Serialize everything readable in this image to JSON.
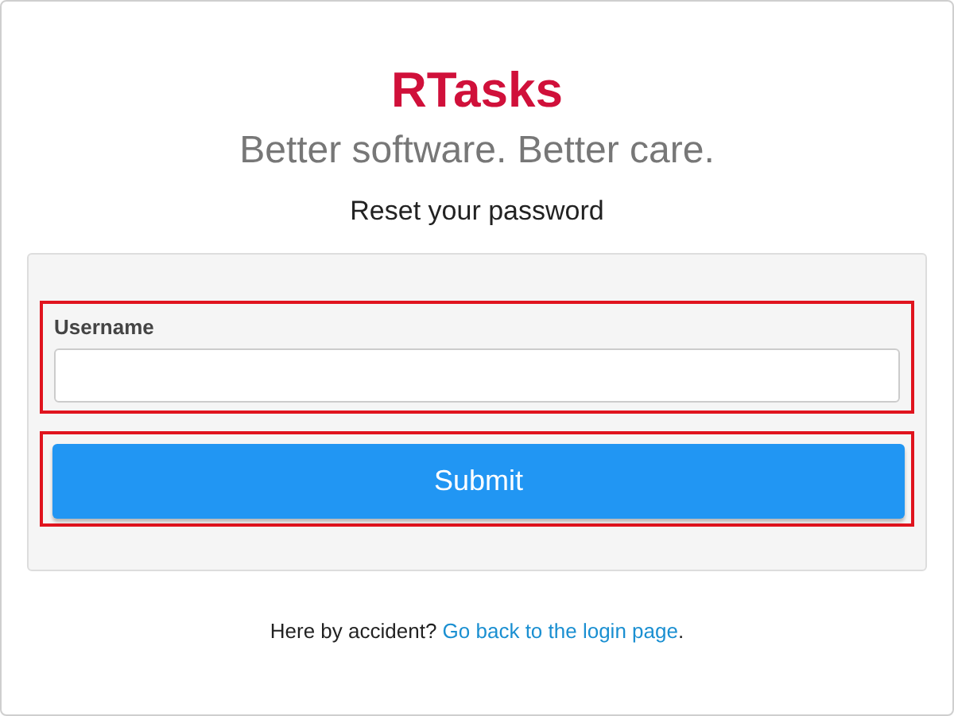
{
  "logo": "RTasks",
  "tagline": "Better software. Better care.",
  "heading": "Reset your password",
  "form": {
    "username": {
      "label": "Username",
      "highlighted": true
    },
    "submit": {
      "label": "Submit",
      "highlighted": true
    }
  },
  "footer": {
    "text": "Here by accident?",
    "link": "Go back to the login page",
    "end": "."
  }
}
